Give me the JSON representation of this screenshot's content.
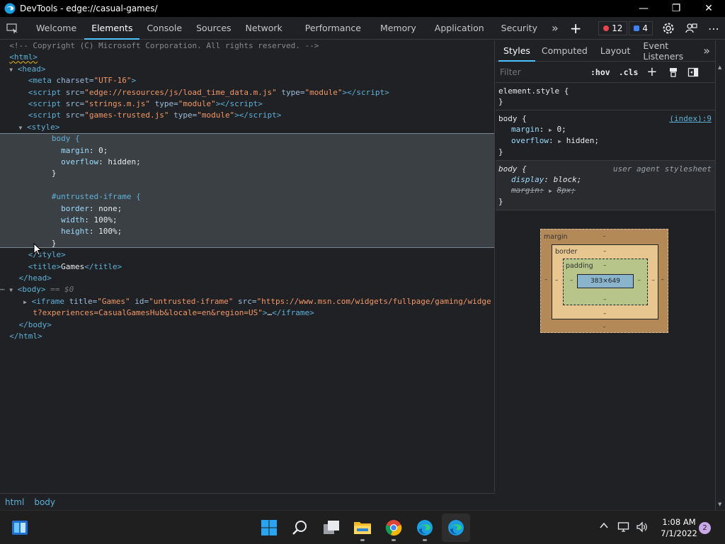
{
  "window": {
    "title": "DevTools - edge://casual-games/",
    "minimize": "—",
    "restore": "❐",
    "close": "✕"
  },
  "toolbar": {
    "tabs": [
      "Welcome",
      "Elements",
      "Console",
      "Sources",
      "Network",
      "Performance",
      "Memory",
      "Application",
      "Security"
    ],
    "active_tab": "Elements",
    "more": "»",
    "add": "+",
    "errors": "12",
    "issues": "4",
    "error_color": "#e8434c",
    "issue_color": "#3b82f6"
  },
  "elements": {
    "comment": "<!-- Copyright (C) Microsoft Corporation. All rights reserved. -->",
    "html_open": "<html>",
    "head_open": "<head>",
    "meta": {
      "tag": "meta",
      "attr": "charset",
      "val": "\"UTF-16\""
    },
    "scripts": [
      {
        "src": "\"edge://resources/js/load_time_data.m.js\"",
        "type": "\"module\""
      },
      {
        "src": "\"strings.m.js\"",
        "type": "\"module\""
      },
      {
        "src": "\"games-trusted.js\"",
        "type": "\"module\""
      }
    ],
    "style_open": "<style>",
    "css_lines": [
      {
        "kind": "sel",
        "text": "body {"
      },
      {
        "kind": "decl",
        "prop": "margin",
        "val": "0;"
      },
      {
        "kind": "decl",
        "prop": "overflow",
        "val": "hidden;"
      },
      {
        "kind": "close",
        "text": "}"
      },
      {
        "kind": "blank",
        "text": ""
      },
      {
        "kind": "sel",
        "text": "#untrusted-iframe {"
      },
      {
        "kind": "decl",
        "prop": "border",
        "val": "none;"
      },
      {
        "kind": "decl",
        "prop": "width",
        "val": "100%;"
      },
      {
        "kind": "decl",
        "prop": "height",
        "val": "100%;"
      },
      {
        "kind": "close",
        "text": "}"
      }
    ],
    "style_close": "</style>",
    "title_open": "<title>",
    "title_text": "Games",
    "title_close": "</title>",
    "head_close": "</head>",
    "body_open": "<body>",
    "body_marker": "== $0",
    "iframe": {
      "title": "\"Games\"",
      "id": "\"untrusted-iframe\"",
      "src_part1": "\"https://www.msn.com/widgets/fullpage/gaming/widge",
      "src_part2": "t?experiences=CasualGamesHub&locale=en&region=US\"",
      "ellipsis": "…",
      "close": "</iframe>"
    },
    "body_close": "</body>",
    "html_close": "</html>"
  },
  "breadcrumb": [
    "html",
    "body"
  ],
  "styles": {
    "tabs": [
      "Styles",
      "Computed",
      "Layout",
      "Event Listeners"
    ],
    "active_tab": "Styles",
    "more": "»",
    "filter_placeholder": "Filter",
    "hov": ":hov",
    "cls": ".cls",
    "element_style_open": "element.style {",
    "element_style_close": "}",
    "body_rule": {
      "selector": "body {",
      "source": "(index):9",
      "decls": [
        {
          "prop": "margin",
          "val": "0;"
        },
        {
          "prop": "overflow",
          "val": "hidden;"
        }
      ],
      "close": "}"
    },
    "ua_rule": {
      "selector": "body {",
      "source": "user agent stylesheet",
      "decls": [
        {
          "prop": "display",
          "val": "block;"
        },
        {
          "prop": "margin",
          "val": "8px;"
        }
      ],
      "close": "}"
    }
  },
  "boxmodel": {
    "margin_label": "margin",
    "border_label": "border",
    "padding_label": "padding",
    "content": "383×649",
    "dash": "–"
  },
  "taskbar": {
    "time": "1:08 AM",
    "date": "7/1/2022",
    "notifications": "2"
  }
}
